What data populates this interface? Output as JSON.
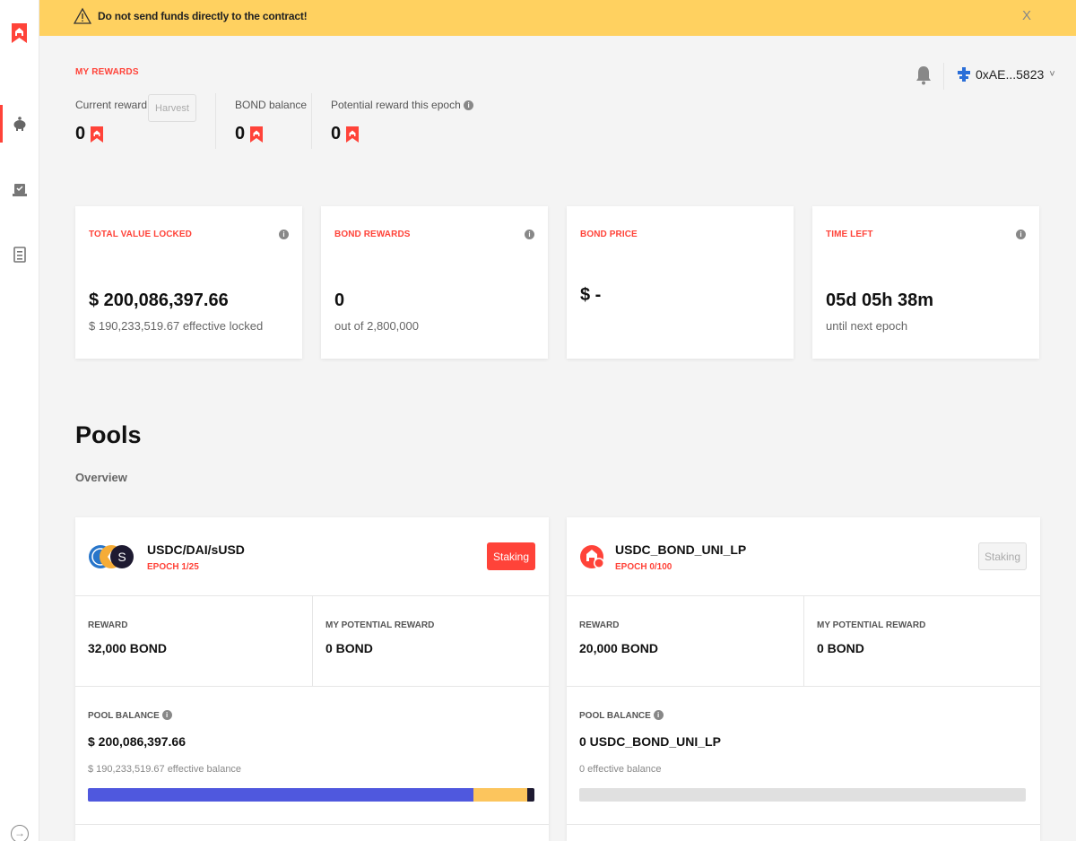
{
  "banner": {
    "text": "Do not send funds directly to the contract!",
    "close": "X"
  },
  "rewards": {
    "title": "MY REWARDS",
    "current_label": "Current reward",
    "current_value": "0",
    "harvest_label": "Harvest",
    "bond_balance_label": "BOND balance",
    "bond_balance_value": "0",
    "potential_label": "Potential reward this epoch",
    "potential_value": "0"
  },
  "wallet": {
    "address": "0xAE...5823",
    "chevron": "˅"
  },
  "stats": [
    {
      "label": "TOTAL VALUE LOCKED",
      "value": "$ 200,086,397.66",
      "sub": "$ 190,233,519.67 effective locked"
    },
    {
      "label": "BOND REWARDS",
      "value": "0",
      "sub": "out of 2,800,000"
    },
    {
      "label": "BOND PRICE",
      "value": "$ -",
      "sub": ""
    },
    {
      "label": "TIME LEFT",
      "value": "05d 05h 38m",
      "sub": "until next epoch"
    }
  ],
  "pools": {
    "title": "Pools",
    "subtitle": "Overview",
    "items": [
      {
        "name": "USDC/DAI/sUSD",
        "epoch": "EPOCH 1/25",
        "staking_label": "Staking",
        "reward_label": "REWARD",
        "reward_value": "32,000 BOND",
        "potential_label": "MY POTENTIAL REWARD",
        "potential_value": "0 BOND",
        "balance_label": "POOL BALANCE",
        "balance_value": "$ 200,086,397.66",
        "effective_text": "$ 190,233,519.67 effective balance",
        "bar_shares": [
          {
            "token": "USDC",
            "fraction": 0.864,
            "color": "#4f58de"
          },
          {
            "token": "DAI",
            "fraction": 0.12,
            "color": "#fcc55d"
          },
          {
            "token": "sUSD",
            "fraction": 0.016,
            "color": "#1e1a31"
          }
        ]
      },
      {
        "name": "USDC_BOND_UNI_LP",
        "epoch": "EPOCH 0/100",
        "staking_label": "Staking",
        "reward_label": "REWARD",
        "reward_value": "20,000 BOND",
        "potential_label": "MY POTENTIAL REWARD",
        "potential_value": "0 BOND",
        "balance_label": "POOL BALANCE",
        "balance_value": "0 USDC_BOND_UNI_LP",
        "effective_text": "0 effective balance",
        "bar_shares": []
      }
    ]
  },
  "colors": {
    "accent": "#ff4339",
    "banner": "#ffd160",
    "background": "#f4f4f4"
  },
  "icons": [
    "bond-logo-icon",
    "piggy-bank-icon",
    "voting-icon",
    "document-icon",
    "logout-icon",
    "warning-icon",
    "bell-icon",
    "wallet-connect-icon",
    "info-icon"
  ]
}
